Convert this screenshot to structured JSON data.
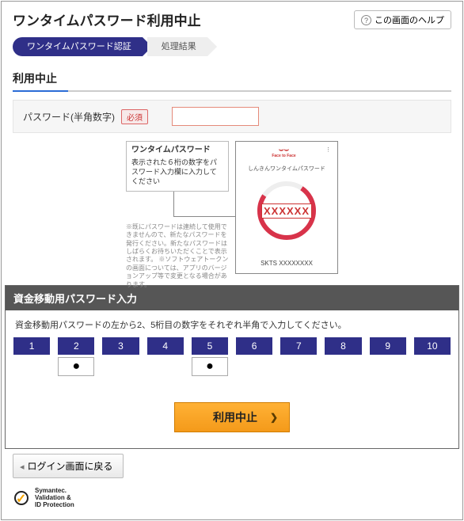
{
  "header": {
    "title": "ワンタイムパスワード利用中止",
    "help_label": "この画面のヘルプ"
  },
  "steps": {
    "active": "ワンタイムパスワード認証",
    "next": "処理結果"
  },
  "section1": {
    "title": "利用中止",
    "pw_label": "パスワード(半角数字)",
    "required": "必須"
  },
  "otp": {
    "note_title": "ワンタイムパスワード",
    "note_body": "表示された６桁の数字をパスワード入力欄に入力してください",
    "fineprint": "※既にパスワードは連続して使用できませんので、新たなパスワードを発行ください。新たなパスワードはしばらくお待ちいただくことで表示されます。\n※ソフトウェアトークンの画面については、アプリのバージョンアップ等で変更となる場合があります。",
    "phone_title": "しんきんワンタイムパスワード",
    "phone_code": "XXXXXX",
    "phone_serial": "SKTS XXXXXXXX",
    "phone_logo_sub": "Face to Face"
  },
  "transfer": {
    "heading": "資金移動用パスワード入力",
    "instruction": "資金移動用パスワードの左から2、5桁目の数字をそれぞれ半角で入力してください。",
    "digits": [
      "1",
      "2",
      "3",
      "4",
      "5",
      "6",
      "7",
      "8",
      "9",
      "10"
    ],
    "active_positions": [
      2,
      5
    ],
    "mask": "●"
  },
  "actions": {
    "submit": "利用中止",
    "back": "ログイン画面に戻る"
  },
  "footer": {
    "symantec1": "Symantec.",
    "symantec2": "Validation &",
    "symantec3": "ID Protection"
  }
}
